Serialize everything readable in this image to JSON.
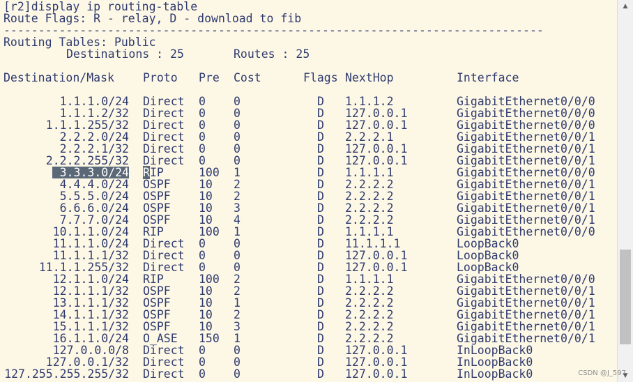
{
  "terminal": {
    "command_line": "[r2]display ip routing-table",
    "flags_line": "Route Flags: R - relay, D - download to fib",
    "separator": "------------------------------------------------------------------------------",
    "tables_line": "Routing Tables: Public",
    "destinations_label": "Destinations : 25",
    "routes_label": "Routes : 25",
    "headers": {
      "dest": "Destination/Mask",
      "proto": "Proto",
      "pre": "Pre",
      "cost": "Cost",
      "flags": "Flags",
      "nexthop": "NextHop",
      "iface": "Interface"
    },
    "rows": [
      {
        "dest": "1.1.1.0/24",
        "proto": "Direct",
        "pre": "0",
        "cost": "0",
        "flags": "D",
        "nexthop": "1.1.1.2",
        "iface": "GigabitEthernet0/0/0"
      },
      {
        "dest": "1.1.1.2/32",
        "proto": "Direct",
        "pre": "0",
        "cost": "0",
        "flags": "D",
        "nexthop": "127.0.0.1",
        "iface": "GigabitEthernet0/0/0"
      },
      {
        "dest": "1.1.1.255/32",
        "proto": "Direct",
        "pre": "0",
        "cost": "0",
        "flags": "D",
        "nexthop": "127.0.0.1",
        "iface": "GigabitEthernet0/0/0"
      },
      {
        "dest": "2.2.2.0/24",
        "proto": "Direct",
        "pre": "0",
        "cost": "0",
        "flags": "D",
        "nexthop": "2.2.2.1",
        "iface": "GigabitEthernet0/0/1"
      },
      {
        "dest": "2.2.2.1/32",
        "proto": "Direct",
        "pre": "0",
        "cost": "0",
        "flags": "D",
        "nexthop": "127.0.0.1",
        "iface": "GigabitEthernet0/0/1"
      },
      {
        "dest": "2.2.2.255/32",
        "proto": "Direct",
        "pre": "0",
        "cost": "0",
        "flags": "D",
        "nexthop": "127.0.0.1",
        "iface": "GigabitEthernet0/0/1"
      },
      {
        "dest": "3.3.3.0/24",
        "proto": "RIP",
        "pre": "100",
        "cost": "1",
        "flags": "D",
        "nexthop": "1.1.1.1",
        "iface": "GigabitEthernet0/0/0",
        "selected": true
      },
      {
        "dest": "4.4.4.0/24",
        "proto": "OSPF",
        "pre": "10",
        "cost": "2",
        "flags": "D",
        "nexthop": "2.2.2.2",
        "iface": "GigabitEthernet0/0/1"
      },
      {
        "dest": "5.5.5.0/24",
        "proto": "OSPF",
        "pre": "10",
        "cost": "2",
        "flags": "D",
        "nexthop": "2.2.2.2",
        "iface": "GigabitEthernet0/0/1"
      },
      {
        "dest": "6.6.6.0/24",
        "proto": "OSPF",
        "pre": "10",
        "cost": "3",
        "flags": "D",
        "nexthop": "2.2.2.2",
        "iface": "GigabitEthernet0/0/1"
      },
      {
        "dest": "7.7.7.0/24",
        "proto": "OSPF",
        "pre": "10",
        "cost": "4",
        "flags": "D",
        "nexthop": "2.2.2.2",
        "iface": "GigabitEthernet0/0/1"
      },
      {
        "dest": "10.1.1.0/24",
        "proto": "RIP",
        "pre": "100",
        "cost": "1",
        "flags": "D",
        "nexthop": "1.1.1.1",
        "iface": "GigabitEthernet0/0/0"
      },
      {
        "dest": "11.1.1.0/24",
        "proto": "Direct",
        "pre": "0",
        "cost": "0",
        "flags": "D",
        "nexthop": "11.1.1.1",
        "iface": "LoopBack0"
      },
      {
        "dest": "11.1.1.1/32",
        "proto": "Direct",
        "pre": "0",
        "cost": "0",
        "flags": "D",
        "nexthop": "127.0.0.1",
        "iface": "LoopBack0"
      },
      {
        "dest": "11.1.1.255/32",
        "proto": "Direct",
        "pre": "0",
        "cost": "0",
        "flags": "D",
        "nexthop": "127.0.0.1",
        "iface": "LoopBack0"
      },
      {
        "dest": "12.1.1.0/24",
        "proto": "RIP",
        "pre": "100",
        "cost": "2",
        "flags": "D",
        "nexthop": "1.1.1.1",
        "iface": "GigabitEthernet0/0/0"
      },
      {
        "dest": "12.1.1.1/32",
        "proto": "OSPF",
        "pre": "10",
        "cost": "2",
        "flags": "D",
        "nexthop": "2.2.2.2",
        "iface": "GigabitEthernet0/0/1"
      },
      {
        "dest": "13.1.1.1/32",
        "proto": "OSPF",
        "pre": "10",
        "cost": "1",
        "flags": "D",
        "nexthop": "2.2.2.2",
        "iface": "GigabitEthernet0/0/1"
      },
      {
        "dest": "14.1.1.1/32",
        "proto": "OSPF",
        "pre": "10",
        "cost": "2",
        "flags": "D",
        "nexthop": "2.2.2.2",
        "iface": "GigabitEthernet0/0/1"
      },
      {
        "dest": "15.1.1.1/32",
        "proto": "OSPF",
        "pre": "10",
        "cost": "3",
        "flags": "D",
        "nexthop": "2.2.2.2",
        "iface": "GigabitEthernet0/0/1"
      },
      {
        "dest": "16.1.1.0/24",
        "proto": "O_ASE",
        "pre": "150",
        "cost": "1",
        "flags": "D",
        "nexthop": "2.2.2.2",
        "iface": "GigabitEthernet0/0/1"
      },
      {
        "dest": "127.0.0.0/8",
        "proto": "Direct",
        "pre": "0",
        "cost": "0",
        "flags": "D",
        "nexthop": "127.0.0.1",
        "iface": "InLoopBack0"
      },
      {
        "dest": "127.0.0.1/32",
        "proto": "Direct",
        "pre": "0",
        "cost": "0",
        "flags": "D",
        "nexthop": "127.0.0.1",
        "iface": "InLoopBack0"
      },
      {
        "dest": "127.255.255.255/32",
        "proto": "Direct",
        "pre": "0",
        "cost": "0",
        "flags": "D",
        "nexthop": "127.0.0.1",
        "iface": "InLoopBack0"
      }
    ]
  },
  "scrollbar": {
    "up_arrow_icon": "arrow-up-icon",
    "down_arrow_icon": "arrow-down-icon"
  },
  "watermark": "CSDN @J_597"
}
